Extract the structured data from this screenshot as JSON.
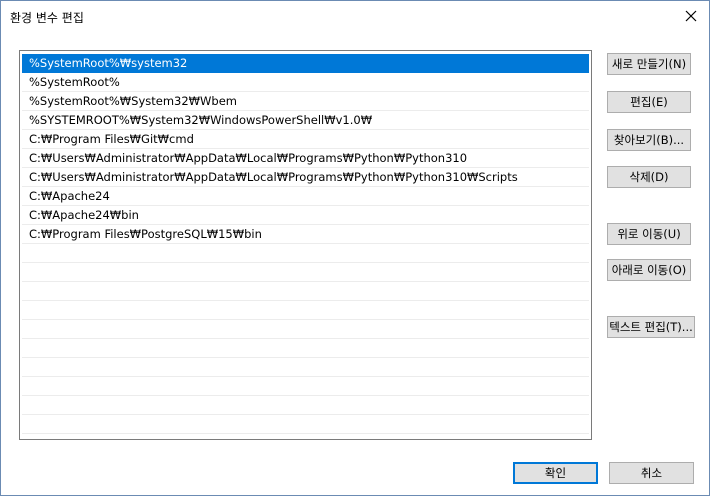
{
  "window": {
    "title": "환경 변수 편집"
  },
  "paths": [
    "%SystemRoot%₩system32",
    "%SystemRoot%",
    "%SystemRoot%₩System32₩Wbem",
    "%SYSTEMROOT%₩System32₩WindowsPowerShell₩v1.0₩",
    "C:₩Program Files₩Git₩cmd",
    "C:₩Users₩Administrator₩AppData₩Local₩Programs₩Python₩Python310",
    "C:₩Users₩Administrator₩AppData₩Local₩Programs₩Python₩Python310₩Scripts",
    "C:₩Apache24",
    "C:₩Apache24₩bin",
    "C:₩Program Files₩PostgreSQL₩15₩bin"
  ],
  "selected_index": 0,
  "buttons": {
    "new": "새로 만들기(N)",
    "edit": "편집(E)",
    "browse": "찾아보기(B)...",
    "delete": "삭제(D)",
    "move_up": "위로 이동(U)",
    "move_down": "아래로 이동(O)",
    "edit_text": "텍스트 편집(T)...",
    "ok": "확인",
    "cancel": "취소"
  },
  "colors": {
    "selection": "#0078d7",
    "button_face": "#e1e1e1",
    "button_border": "#adadad"
  }
}
